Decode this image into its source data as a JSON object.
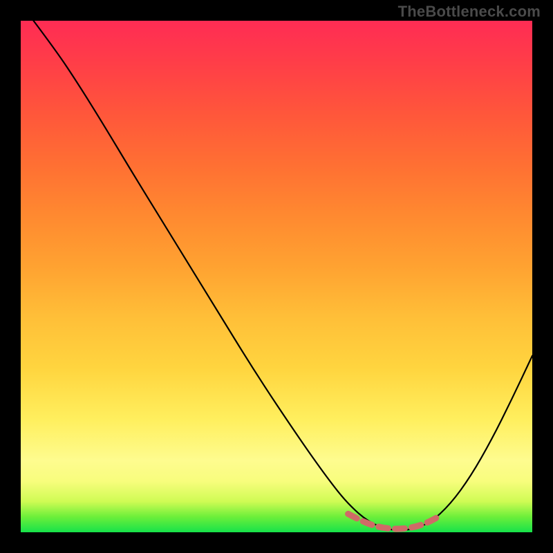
{
  "watermark": "TheBottleneck.com",
  "chart_data": {
    "type": "line",
    "title": "",
    "xlabel": "",
    "ylabel": "",
    "xlim": [
      0,
      1
    ],
    "ylim": [
      0,
      1
    ],
    "note": "Axes are unlabeled; values are normalized fractions of the plot area. y=1 is top (red), y=0 is bottom (green). The curve depicts a V-shape with minimum near x≈0.73.",
    "series": [
      {
        "name": "bottleneck-curve",
        "points": [
          {
            "x": 0.025,
            "y": 1.0
          },
          {
            "x": 0.07,
            "y": 0.94
          },
          {
            "x": 0.11,
            "y": 0.88
          },
          {
            "x": 0.16,
            "y": 0.8
          },
          {
            "x": 0.22,
            "y": 0.7
          },
          {
            "x": 0.3,
            "y": 0.57
          },
          {
            "x": 0.38,
            "y": 0.44
          },
          {
            "x": 0.46,
            "y": 0.31
          },
          {
            "x": 0.54,
            "y": 0.19
          },
          {
            "x": 0.6,
            "y": 0.105
          },
          {
            "x": 0.64,
            "y": 0.055
          },
          {
            "x": 0.68,
            "y": 0.02
          },
          {
            "x": 0.72,
            "y": 0.004
          },
          {
            "x": 0.76,
            "y": 0.004
          },
          {
            "x": 0.8,
            "y": 0.018
          },
          {
            "x": 0.84,
            "y": 0.055
          },
          {
            "x": 0.88,
            "y": 0.11
          },
          {
            "x": 0.92,
            "y": 0.18
          },
          {
            "x": 0.96,
            "y": 0.26
          },
          {
            "x": 1.0,
            "y": 0.345
          }
        ]
      }
    ],
    "highlight_range": {
      "name": "optimal-zone",
      "description": "Dashed salmon segment near curve minimum",
      "points": [
        {
          "x": 0.64,
          "y": 0.036
        },
        {
          "x": 0.67,
          "y": 0.02
        },
        {
          "x": 0.7,
          "y": 0.01
        },
        {
          "x": 0.73,
          "y": 0.006
        },
        {
          "x": 0.76,
          "y": 0.008
        },
        {
          "x": 0.79,
          "y": 0.016
        },
        {
          "x": 0.82,
          "y": 0.032
        }
      ]
    },
    "background_gradient": {
      "bottom": "#16e24a",
      "mid": "#fef160",
      "top": "#ff2c54"
    }
  }
}
